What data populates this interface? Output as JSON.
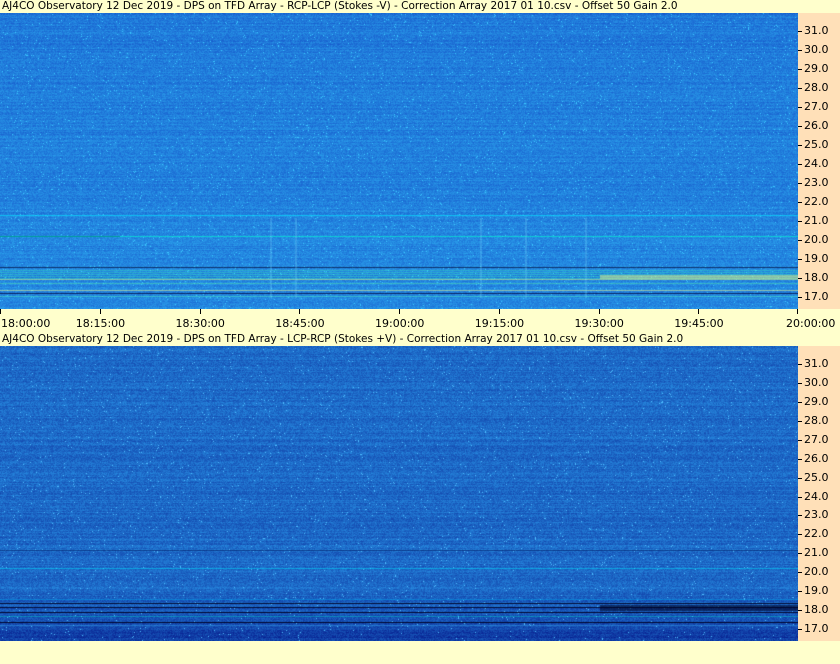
{
  "panels": [
    {
      "title": "AJ4CO Observatory 12 Dec 2019  -  DPS on TFD Array  -  RCP-LCP (Stokes -V)  -  Correction Array 2017 01 10.csv  -  Offset 50  Gain 2.0",
      "variant": "stokes-minus-v"
    },
    {
      "title": "AJ4CO Observatory 12 Dec 2019  -  DPS on TFD Array  -  LCP-RCP (Stokes +V)  -  Correction Array 2017 01 10.csv  -  Offset 50  Gain 2.0",
      "variant": "stokes-plus-v"
    }
  ],
  "freq_ticks": [
    "31.0",
    "30.0",
    "29.0",
    "28.0",
    "27.0",
    "26.0",
    "25.0",
    "24.0",
    "23.0",
    "22.0",
    "21.0",
    "20.0",
    "19.0",
    "18.0",
    "17.0"
  ],
  "time_ticks": [
    "18:00:00",
    "18:15:00",
    "18:30:00",
    "18:45:00",
    "19:00:00",
    "19:15:00",
    "19:30:00",
    "19:45:00",
    "20:00:00"
  ],
  "colors": {
    "background": "#ffffcc",
    "axis_bg": "#ffe0b8",
    "spectrogram_base": "#1a5ce0"
  }
}
